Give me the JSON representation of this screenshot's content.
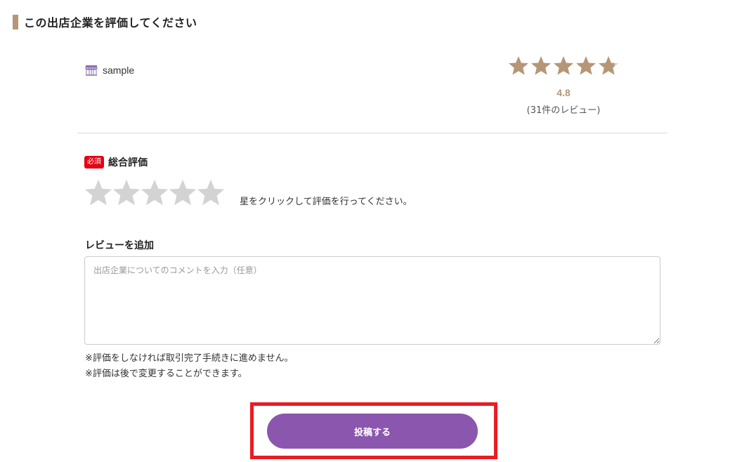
{
  "heading": "この出店企業を評価してください",
  "shop": {
    "icon": "storefront-icon",
    "name": "sample"
  },
  "average": {
    "score": "4.8",
    "score_value": 4.8,
    "max_stars": 5,
    "count_text": "(31件のレビュー)"
  },
  "rating": {
    "required_badge": "必須",
    "label": "総合評価",
    "hint": "星をクリックして評価を行ってください。",
    "selected": 0,
    "max_stars": 5
  },
  "review": {
    "label": "レビューを追加",
    "placeholder": "出店企業についてのコメントを入力（任意）",
    "value": ""
  },
  "notes": [
    "※評価をしなければ取引完了手続きに進めません。",
    "※評価は後で変更することができます。"
  ],
  "submit": {
    "label": "投稿する"
  },
  "colors": {
    "accent": "#b59677",
    "star_empty": "#d3d3d3",
    "button": "#8b56ad",
    "required": "#e60012",
    "highlight_frame": "#ea1c24"
  }
}
